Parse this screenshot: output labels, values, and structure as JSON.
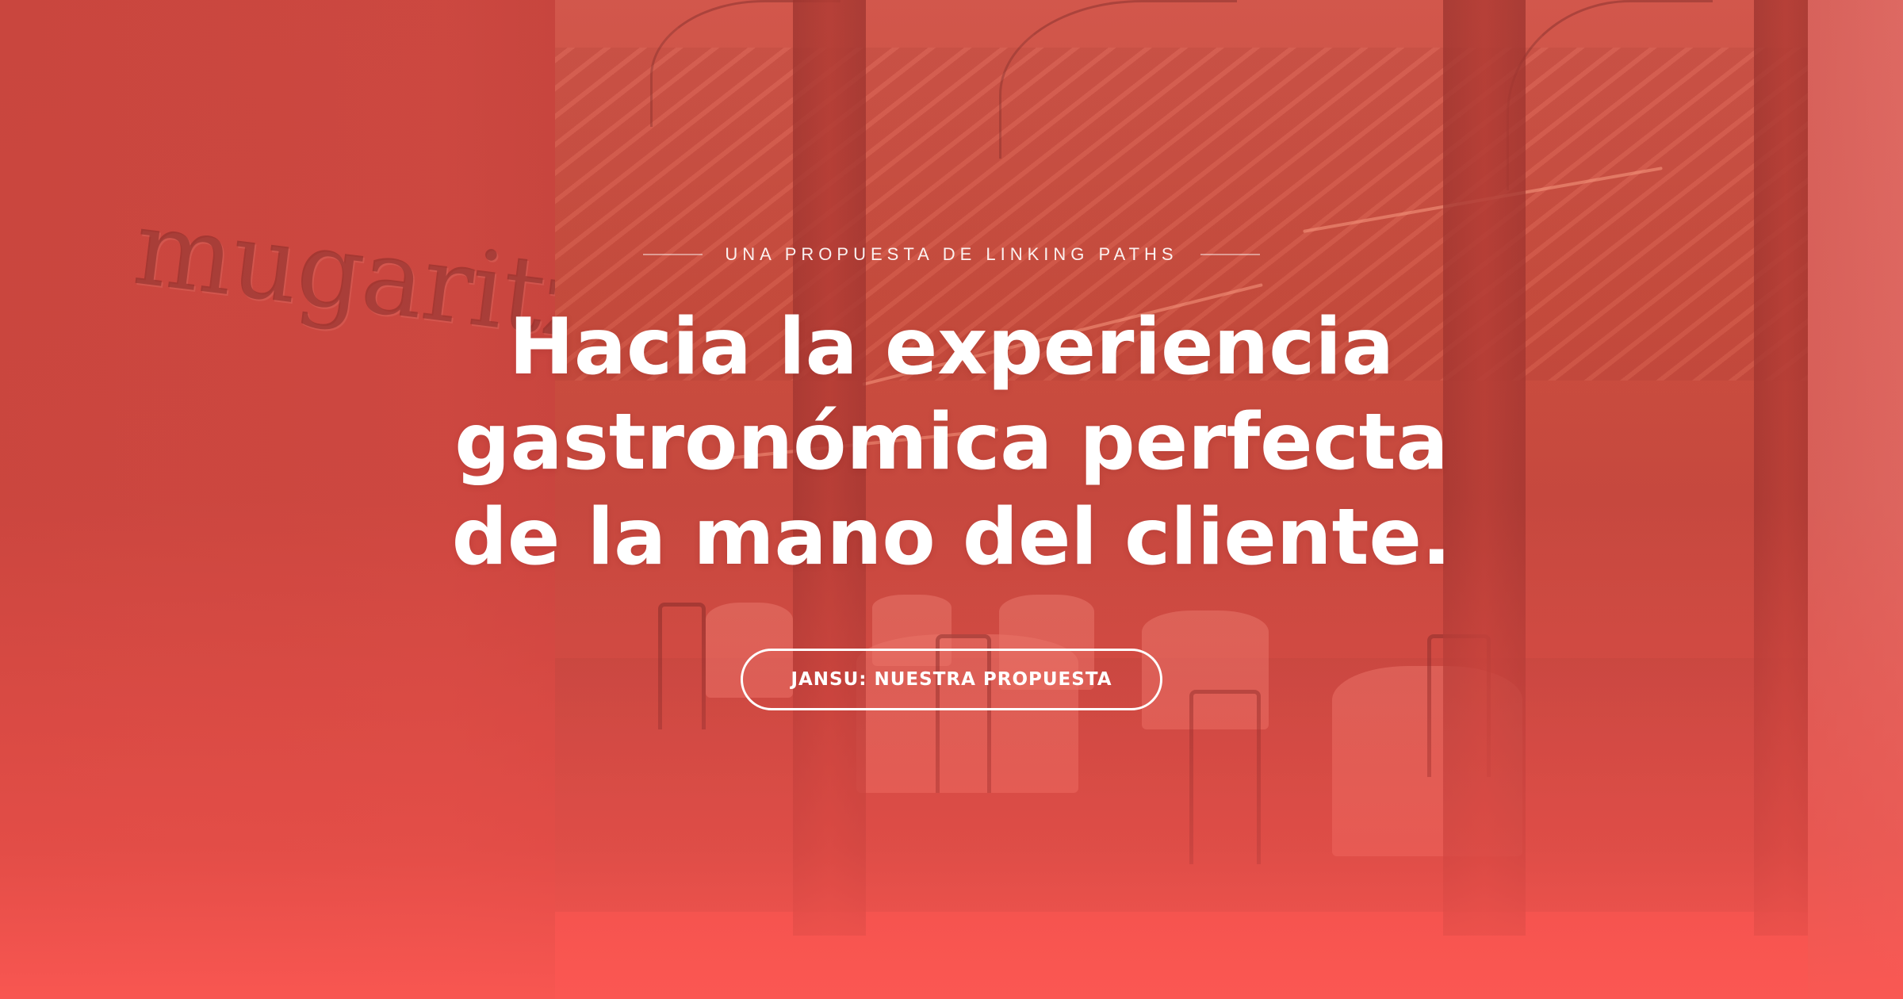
{
  "hero": {
    "background_logo_text": "mugaritz",
    "eyebrow": "UNA PROPUESTA DE LINKING PATHS",
    "headline_lines": [
      "Hacia la experiencia",
      "gastronómica perfecta",
      "de la mano del cliente."
    ],
    "cta_label": "JANSU: NUESTRA PROPUESTA"
  },
  "colors": {
    "tint_top": "#c2433d",
    "tint_bottom": "#fb5752",
    "text": "#ffffff"
  }
}
